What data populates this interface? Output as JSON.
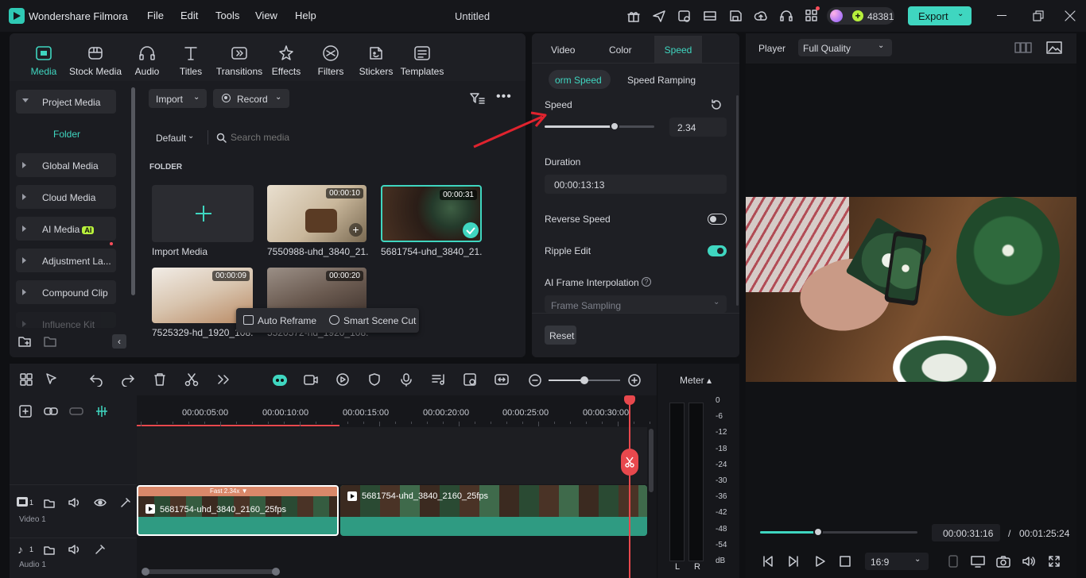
{
  "app": {
    "name": "Wondershare Filmora",
    "doc_title": "Untitled",
    "credits": "48381",
    "export_label": "Export"
  },
  "menu": [
    "File",
    "Edit",
    "Tools",
    "View",
    "Help"
  ],
  "media_tabs": [
    {
      "label": "Media",
      "icon": "media-icon",
      "active": true
    },
    {
      "label": "Stock Media",
      "icon": "stock-media-icon"
    },
    {
      "label": "Audio",
      "icon": "audio-icon"
    },
    {
      "label": "Titles",
      "icon": "titles-icon"
    },
    {
      "label": "Transitions",
      "icon": "transitions-icon"
    },
    {
      "label": "Effects",
      "icon": "effects-icon"
    },
    {
      "label": "Filters",
      "icon": "filters-icon"
    },
    {
      "label": "Stickers",
      "icon": "stickers-icon"
    },
    {
      "label": "Templates",
      "icon": "templates-icon"
    }
  ],
  "sidebar": {
    "project_media": "Project Media",
    "folder": "Folder",
    "items": [
      "Global Media",
      "Cloud Media",
      "AI Media",
      "Adjustment La...",
      "Compound Clip",
      "Influence Kit"
    ],
    "ai_badge": "AI"
  },
  "media_toolbar": {
    "import": "Import",
    "record": "Record",
    "sort": "Default",
    "search_placeholder": "Search media",
    "folder_heading": "FOLDER"
  },
  "media_items": [
    {
      "name": "Import Media"
    },
    {
      "name": "7550988-uhd_3840_21...",
      "duration": "00:00:10"
    },
    {
      "name": "5681754-uhd_3840_21...",
      "duration": "00:00:31"
    },
    {
      "name": "7525329-hd_1920_108...",
      "duration": "00:00:09"
    },
    {
      "name": "5520572-hd_1920_108...",
      "duration": "00:00:20"
    }
  ],
  "popover": {
    "auto_reframe": "Auto Reframe",
    "smart_scene_cut": "Smart Scene Cut"
  },
  "properties": {
    "tabs": [
      "Video",
      "Color",
      "Speed"
    ],
    "active_tab": "Speed",
    "subtabs": [
      "orm Speed",
      "Speed Ramping"
    ],
    "speed_label": "Speed",
    "speed_value": "2.34",
    "speed_slider_fraction": 0.64,
    "duration_label": "Duration",
    "duration_value": "00:00:13:13",
    "reverse_label": "Reverse Speed",
    "reverse_on": false,
    "ripple_label": "Ripple Edit",
    "ripple_on": true,
    "ai_interp_label": "AI Frame Interpolation",
    "frame_sampling": "Frame Sampling",
    "reset": "Reset"
  },
  "player": {
    "label": "Player",
    "quality": "Full Quality",
    "current_time": "00:00:31:16",
    "separator": "/",
    "total_time": "00:01:25:24",
    "progress_fraction": 0.37,
    "aspect": "16:9"
  },
  "meter": {
    "label": "Meter ▴",
    "scale": [
      "0",
      "-6",
      "-12",
      "-18",
      "-24",
      "-30",
      "-36",
      "-42",
      "-48",
      "-54",
      "dB"
    ],
    "left": "L",
    "right": "R"
  },
  "timeline": {
    "ruler": [
      "00:00:05:00",
      "00:00:10:00",
      "00:00:15:00",
      "00:00:20:00",
      "00:00:25:00",
      "00:00:30:00"
    ],
    "video_track": "Video 1",
    "audio_track": "Audio 1",
    "track_num_video": "1",
    "track_num_audio": "1",
    "clip1_name": "5681754-uhd_3840_2160_25fps",
    "clip1_speed": "Fast 2.34x ▼",
    "clip2_name": "5681754-uhd_3840_2160_25fps"
  },
  "colors": {
    "accent": "#3fd6c0",
    "playhead": "#e8484d",
    "panel": "#1e1f24",
    "clip": "#2f9b82"
  }
}
